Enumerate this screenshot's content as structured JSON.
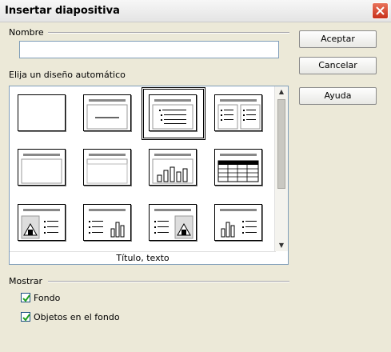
{
  "window": {
    "title": "Insertar diapositiva"
  },
  "name_group": {
    "label": "Nombre",
    "value": ""
  },
  "layout_group": {
    "label": "Elija un diseño automático",
    "caption": "Título, texto"
  },
  "layouts": [
    {
      "id": "blank"
    },
    {
      "id": "title-only"
    },
    {
      "id": "title-text"
    },
    {
      "id": "title-2-text"
    },
    {
      "id": "title-only-2"
    },
    {
      "id": "title-content"
    },
    {
      "id": "title-chart"
    },
    {
      "id": "title-table"
    },
    {
      "id": "title-clipart-text"
    },
    {
      "id": "title-text-chart"
    },
    {
      "id": "title-text-clipart"
    },
    {
      "id": "title-chart-text"
    }
  ],
  "selected_layout": "title-text",
  "buttons": {
    "ok": "Aceptar",
    "cancel": "Cancelar",
    "help": "Ayuda"
  },
  "show_group": {
    "label": "Mostrar",
    "background": {
      "label": "Fondo",
      "checked": true
    },
    "background_objects": {
      "label": "Objetos en el fondo",
      "checked": true
    }
  }
}
